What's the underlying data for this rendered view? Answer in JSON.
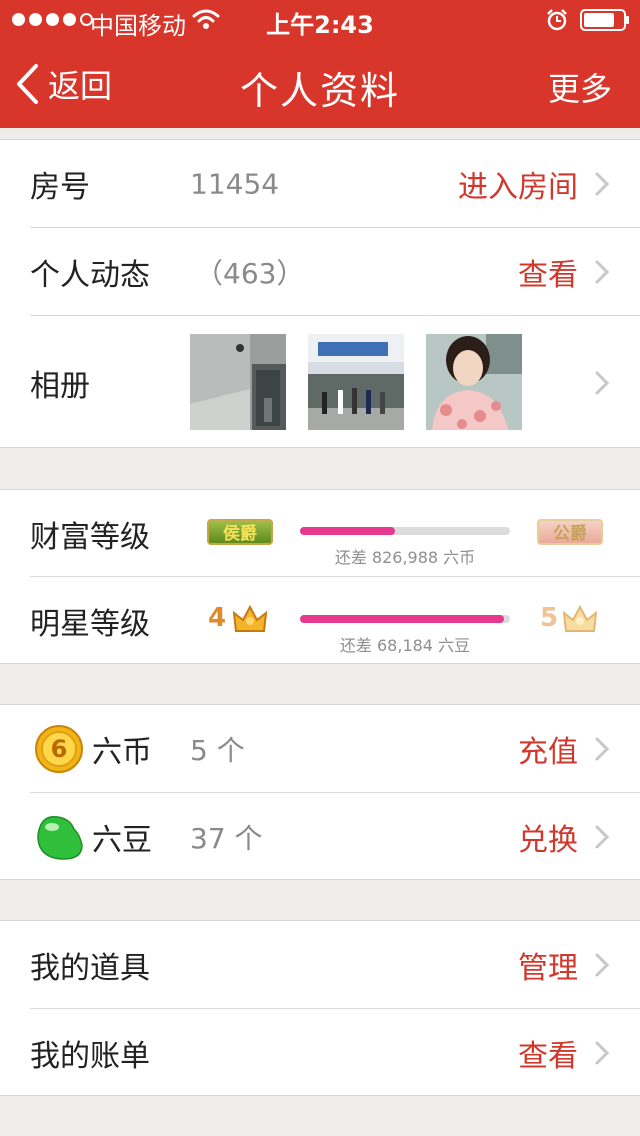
{
  "status_bar": {
    "carrier": "中国移动",
    "time": "上午2:43"
  },
  "nav": {
    "back_label": "返回",
    "title": "个人资料",
    "more_label": "更多"
  },
  "info": {
    "room": {
      "label": "房号",
      "value": "11454",
      "action": "进入房间"
    },
    "moments": {
      "label": "个人动态",
      "value": "（463）",
      "action": "查看"
    },
    "album": {
      "label": "相册"
    }
  },
  "levels": {
    "wealth": {
      "label": "财富等级",
      "current_badge": "侯爵",
      "next_badge": "公爵",
      "progress": 0.45,
      "remaining_text": "还差 826,988 六币"
    },
    "star": {
      "label": "明星等级",
      "current_level": "4",
      "next_level": "5",
      "progress": 0.97,
      "remaining_text": "还差 68,184 六豆"
    }
  },
  "currency": {
    "coins": {
      "label": "六币",
      "value": "5 个",
      "action": "充值",
      "icon_char": "6"
    },
    "beans": {
      "label": "六豆",
      "value": "37 个",
      "action": "兑换"
    }
  },
  "misc": {
    "props": {
      "label": "我的道具",
      "action": "管理"
    },
    "bill": {
      "label": "我的账单",
      "action": "查看"
    }
  },
  "colors": {
    "brand_red": "#d9362b",
    "action_red": "#d0382c",
    "progress_pink": "#e6388e"
  }
}
